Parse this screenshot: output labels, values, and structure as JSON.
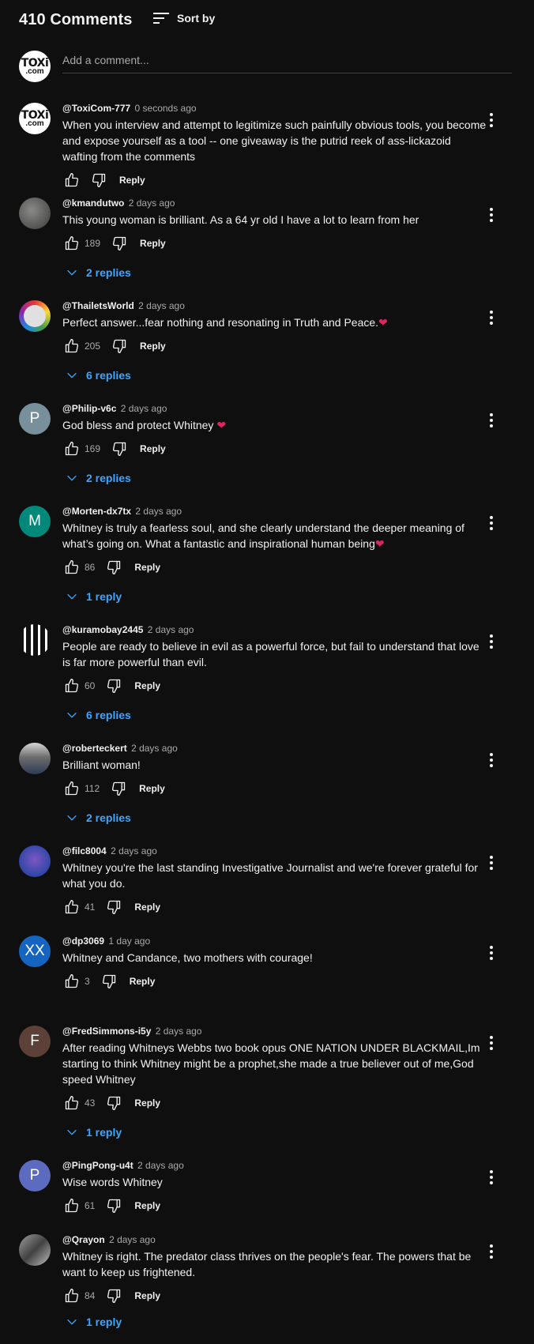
{
  "header": {
    "count_label": "410 Comments",
    "sort_label": "Sort by"
  },
  "add_comment": {
    "placeholder": "Add a comment..."
  },
  "reply_label": "Reply",
  "comments": [
    {
      "author": "@ToxiCom-777",
      "time": "0 seconds ago",
      "text": "When you interview and attempt to legitimize such painfully obvious tools, you become and expose yourself as a tool -- one giveaway is the putrid reek of ass-lickazoid wafting from the comments",
      "likes": "",
      "replies": ""
    },
    {
      "author": "@kmandutwo",
      "time": "2 days ago",
      "text": "This young woman is brilliant. As a 64 yr old I have a lot to learn from her",
      "likes": "189",
      "replies": "2 replies"
    },
    {
      "author": "@ThailetsWorld",
      "time": "2 days ago",
      "text": "Perfect answer...fear nothing and resonating in Truth and Peace.",
      "likes": "205",
      "replies": "6 replies"
    },
    {
      "author": "@Philip-v6c",
      "time": "2 days ago",
      "text": "God bless and protect Whitney",
      "likes": "169",
      "replies": "2 replies",
      "avatar_letter": "P"
    },
    {
      "author": "@Morten-dx7tx",
      "time": "2 days ago",
      "text": "Whitney is truly a fearless soul, and she clearly understand the deeper meaning of what’s going on. What a fantastic and inspirational human being",
      "likes": "86",
      "replies": "1 reply",
      "avatar_letter": "M"
    },
    {
      "author": "@kuramobay2445",
      "time": "2 days ago",
      "text": "People are ready to believe in evil as a powerful force, but fail to understand that love is far more powerful than evil.",
      "likes": "60",
      "replies": "6 replies"
    },
    {
      "author": "@roberteckert",
      "time": "2 days ago",
      "text": "Brilliant woman!",
      "likes": "112",
      "replies": "2 replies"
    },
    {
      "author": "@filc8004",
      "time": "2 days ago",
      "text": "Whitney you're the last standing Investigative Journalist and we're forever grateful for what you do.",
      "likes": "41",
      "replies": ""
    },
    {
      "author": "@dp3069",
      "time": "1 day ago",
      "text": "Whitney and Candance, two mothers with courage!",
      "likes": "3",
      "replies": "",
      "avatar_letter": "XX"
    },
    {
      "author": "@FredSimmons-i5y",
      "time": "2 days ago",
      "text": "After reading Whitneys Webbs two book opus ONE NATION UNDER BLACKMAIL,Im starting to think Whitney might be a prophet,she made a true believer out of me,God speed Whitney",
      "likes": "43",
      "replies": "1 reply",
      "avatar_letter": "F"
    },
    {
      "author": "@PingPong-u4t",
      "time": "2 days ago",
      "text": "Wise words Whitney",
      "likes": "61",
      "replies": "",
      "avatar_letter": "P"
    },
    {
      "author": "@Qrayon",
      "time": "2 days ago",
      "text": "Whitney is right.  The predator class thrives on the people's fear.   The powers that be want to keep us frightened.",
      "likes": "84",
      "replies": "1 reply"
    }
  ],
  "colors": {
    "background": "#0f0f0f",
    "link": "#3ea6ff",
    "muted": "#aaaaaa",
    "heart": "#e0245e"
  }
}
